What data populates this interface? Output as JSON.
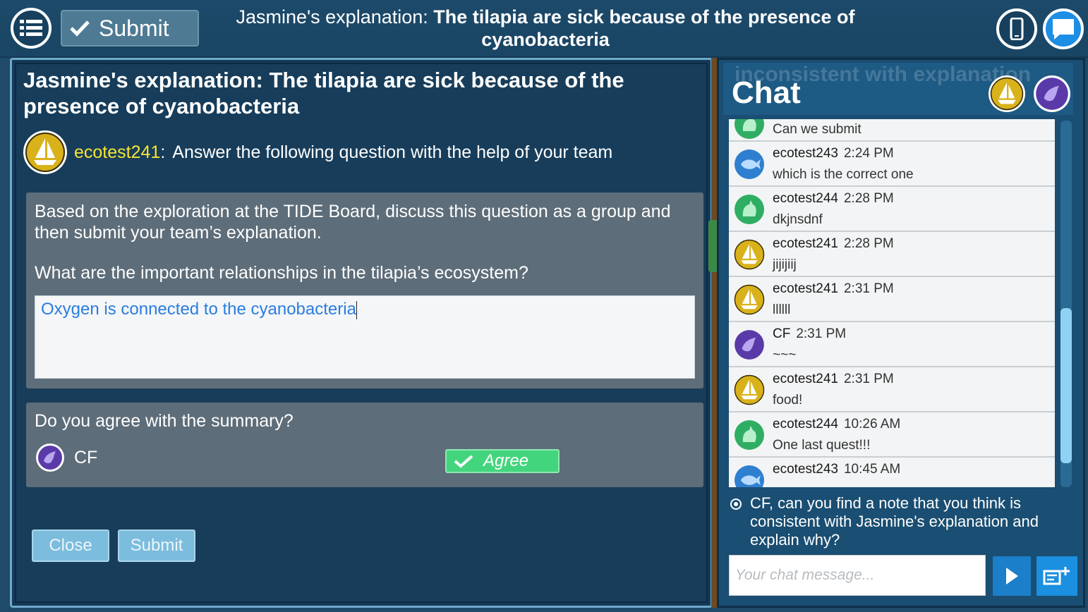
{
  "topbar": {
    "submit_label": "Submit",
    "title_prefix": "Jasmine's explanation: ",
    "title_bold": "The tilapia are sick because of the presence of cyanobacteria"
  },
  "panel": {
    "title": "Jasmine's explanation: The tilapia are sick because of the presence of cyanobacteria",
    "author_name": "ecotest241",
    "author_sep": ":",
    "author_text": "Answer the following question with the help of your team",
    "question_intro": "Based on the exploration at the TIDE Board, discuss this question as a group and then submit your team’s explanation.",
    "question": "What are the important relationships in the tilapia’s ecosystem?",
    "answer": "Oxygen is connected to the cyanobacteria",
    "agree_question": "Do you agree with the summary?",
    "agree_user": "CF",
    "agree_label": "Agree",
    "close_label": "Close",
    "submit_label": "Submit"
  },
  "chat": {
    "ghost_text": "inconsistent with explanation",
    "title": "Chat",
    "messages": [
      {
        "name": "",
        "time": "",
        "text": "Can we submit",
        "avatar": "cat-green"
      },
      {
        "name": "ecotest243",
        "time": "2:24 PM",
        "text": "which is the correct one",
        "avatar": "fish-blue"
      },
      {
        "name": "ecotest244",
        "time": "2:28 PM",
        "text": "dkjnsdnf",
        "avatar": "cat-green"
      },
      {
        "name": "ecotest241",
        "time": "2:28 PM",
        "text": "jijijiij",
        "avatar": "boat-yellow"
      },
      {
        "name": "ecotest241",
        "time": "2:31 PM",
        "text": "llllll",
        "avatar": "boat-yellow"
      },
      {
        "name": "CF",
        "time": "2:31 PM",
        "text": "~~~",
        "avatar": "bird-purple"
      },
      {
        "name": "ecotest241",
        "time": "2:31 PM",
        "text": "food!",
        "avatar": "boat-yellow"
      },
      {
        "name": "ecotest244",
        "time": "10:26 AM",
        "text": "One last quest!!!",
        "avatar": "cat-green"
      },
      {
        "name": "ecotest243",
        "time": "10:45 AM",
        "text": "",
        "avatar": "fish-blue"
      }
    ],
    "prompt": "CF, can you find a note that you think is consistent with Jasmine's explanation and explain why?",
    "input_placeholder": "Your chat message..."
  },
  "colors": {
    "accent_yellow": "#f6e433",
    "agree_green": "#43d57d",
    "answer_blue": "#2a7de1",
    "boat": "#d9b21b",
    "bird": "#5a3aa8",
    "cat": "#2fae63",
    "fish": "#2f7fd0"
  }
}
